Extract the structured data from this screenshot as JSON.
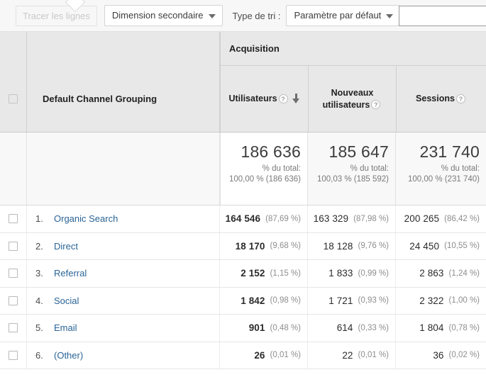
{
  "toolbar": {
    "plot_rows_label": "Tracer les lignes",
    "secondary_dimension_label": "Dimension secondaire",
    "sort_type_label": "Type de tri :",
    "sort_type_value": "Paramètre par défaut",
    "search_value": "",
    "search_placeholder": ""
  },
  "table": {
    "group_header": "Acquisition",
    "dimension_header": "Default Channel Grouping",
    "metric_headers": [
      {
        "line1": "Utilisateurs",
        "line2": "",
        "sorted": true
      },
      {
        "line1": "Nouveaux",
        "line2": "utilisateurs",
        "sorted": false
      },
      {
        "line1": "Sessions",
        "line2": "",
        "sorted": false
      }
    ],
    "help_icon_label": "?",
    "totals": [
      {
        "value": "186 636",
        "sub_label": "% du total:",
        "sub_value": "100,00 % (186 636)"
      },
      {
        "value": "185 647",
        "sub_label": "% du total:",
        "sub_value": "100,03 % (185 592)"
      },
      {
        "value": "231 740",
        "sub_label": "% du total:",
        "sub_value": "100,00 % (231 740)"
      }
    ],
    "rows": [
      {
        "rank": "1.",
        "name": "Organic Search",
        "m1": "164 546",
        "m1p": "(87,69 %)",
        "m2": "163 329",
        "m2p": "(87,98 %)",
        "m3": "200 265",
        "m3p": "(86,42 %)"
      },
      {
        "rank": "2.",
        "name": "Direct",
        "m1": "18 170",
        "m1p": "(9,68 %)",
        "m2": "18 128",
        "m2p": "(9,76 %)",
        "m3": "24 450",
        "m3p": "(10,55 %)"
      },
      {
        "rank": "3.",
        "name": "Referral",
        "m1": "2 152",
        "m1p": "(1,15 %)",
        "m2": "1 833",
        "m2p": "(0,99 %)",
        "m3": "2 863",
        "m3p": "(1,24 %)"
      },
      {
        "rank": "4.",
        "name": "Social",
        "m1": "1 842",
        "m1p": "(0,98 %)",
        "m2": "1 721",
        "m2p": "(0,93 %)",
        "m3": "2 322",
        "m3p": "(1,00 %)"
      },
      {
        "rank": "5.",
        "name": "Email",
        "m1": "901",
        "m1p": "(0,48 %)",
        "m2": "614",
        "m2p": "(0,33 %)",
        "m3": "1 804",
        "m3p": "(0,78 %)"
      },
      {
        "rank": "6.",
        "name": "(Other)",
        "m1": "26",
        "m1p": "(0,01 %)",
        "m2": "22",
        "m2p": "(0,01 %)",
        "m3": "36",
        "m3p": "(0,02 %)"
      }
    ]
  },
  "colors": {
    "link": "#2a6496",
    "header_bg": "#e8e8e8",
    "totals_bg": "#f8f8f8",
    "toolbar_bg": "#f7f7f7"
  }
}
